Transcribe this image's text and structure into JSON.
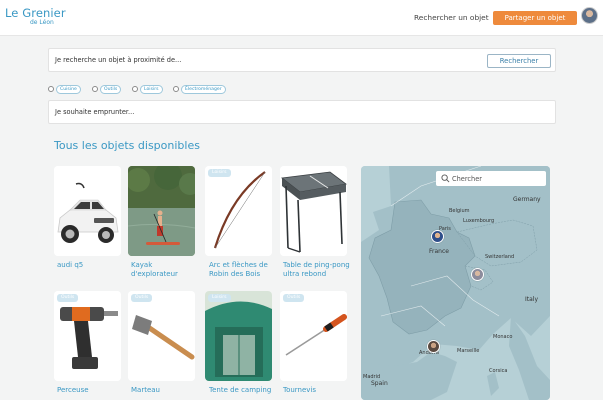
{
  "header": {
    "logo_title": "Le Grenier",
    "logo_subtitle": "de Léon",
    "nav_search": "Rechercher un objet",
    "share_button": "Partager un objet"
  },
  "search": {
    "text": "Je recherche un objet à proximité de...",
    "button": "Rechercher"
  },
  "categories": [
    "Cuisine",
    "Outils",
    "Loisirs",
    "Électroménager"
  ],
  "borrow": {
    "text": "Je souhaite emprunter..."
  },
  "section_title": "Tous les objets disponibles",
  "items": [
    {
      "label": "audi q5",
      "badge": ""
    },
    {
      "label": "Kayak d'explorateur",
      "badge": ""
    },
    {
      "label": "Arc et flèches de Robin des Bois",
      "badge": "Loisirs"
    },
    {
      "label": "Table de ping-pong ultra rebond",
      "badge": ""
    },
    {
      "label": "Perceuse",
      "badge": "Outils"
    },
    {
      "label": "Marteau",
      "badge": "Outils"
    },
    {
      "label": "Tente de camping",
      "badge": "Loisirs"
    },
    {
      "label": "Tournevis",
      "badge": "Outils"
    }
  ],
  "map": {
    "search_placeholder": "Chercher",
    "labels": {
      "belgium": "Belgium",
      "luxembourg": "Luxembourg",
      "paris": "Paris",
      "france": "France",
      "switzerland": "Switzerland",
      "germany": "Germany",
      "italy": "Italy",
      "spain": "Spain",
      "andorra": "Andorra",
      "madrid": "Madrid",
      "monaco": "Monaco",
      "marseille": "Marseille",
      "corsica": "Corsica"
    }
  },
  "colors": {
    "accent": "#3a98c4",
    "cta": "#ee8a3c",
    "background": "#f3f4f4",
    "map_water": "#b6d0d6",
    "map_land": "#9fbcc4"
  }
}
